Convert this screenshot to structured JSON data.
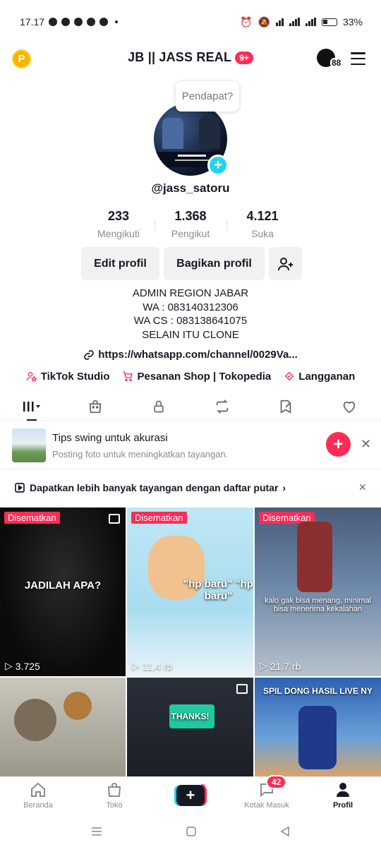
{
  "status_bar": {
    "time": "17.17",
    "battery": "33%"
  },
  "header": {
    "title": "JB || JASS REAL",
    "badge": "9+",
    "coin_letter": "P",
    "dark_mode_count": "88"
  },
  "profile": {
    "tooltip": "Pendapat?",
    "username": "@jass_satoru",
    "stats": [
      {
        "value": "233",
        "label": "Mengikuti"
      },
      {
        "value": "1.368",
        "label": "Pengikut"
      },
      {
        "value": "4.121",
        "label": "Suka"
      }
    ],
    "buttons": {
      "edit": "Edit profil",
      "share": "Bagikan profil"
    },
    "bio": [
      "ADMIN REGION JABAR",
      "WA : 083140312306",
      "WA CS : 083138641075",
      "SELAIN ITU CLONE"
    ],
    "link": "https://whatsapp.com/channel/0029Va...",
    "shortcuts": [
      "TikTok Studio",
      "Pesanan Shop | Tokopedia",
      "Langganan"
    ]
  },
  "tips": {
    "title": "Tips swing untuk akurasi",
    "subtitle": "Posting foto untuk meningkatkan tayangan."
  },
  "playlist": {
    "text": "Dapatkan lebih banyak tayangan dengan daftar putar",
    "chevron": "›"
  },
  "videos": [
    {
      "pinned": "Disematkan",
      "caption": "JADILAH APA?",
      "views": "3.725"
    },
    {
      "pinned": "Disematkan",
      "caption": "\"hp baru\" \"hp baru\"",
      "views": "11,4 rb"
    },
    {
      "pinned": "Disematkan",
      "caption": "kalo gak bisa menang, minimal bisa menerima kekalahan",
      "views": "21,7 rb"
    },
    {
      "pinned": "",
      "caption": "",
      "views": ""
    },
    {
      "pinned": "",
      "caption": "THANKS!",
      "views": ""
    },
    {
      "pinned": "",
      "caption": "SPIL DONG HASIL LIVE NY",
      "views": ""
    }
  ],
  "bottom_nav": {
    "home": "Beranda",
    "shop": "Toko",
    "create": "+",
    "inbox": "Kotak Masuk",
    "inbox_badge": "42",
    "profile": "Profil"
  },
  "colors": {
    "accent": "#fe2c55",
    "cyan": "#20d5ec",
    "text": "#161823",
    "muted": "#8a8b91"
  }
}
